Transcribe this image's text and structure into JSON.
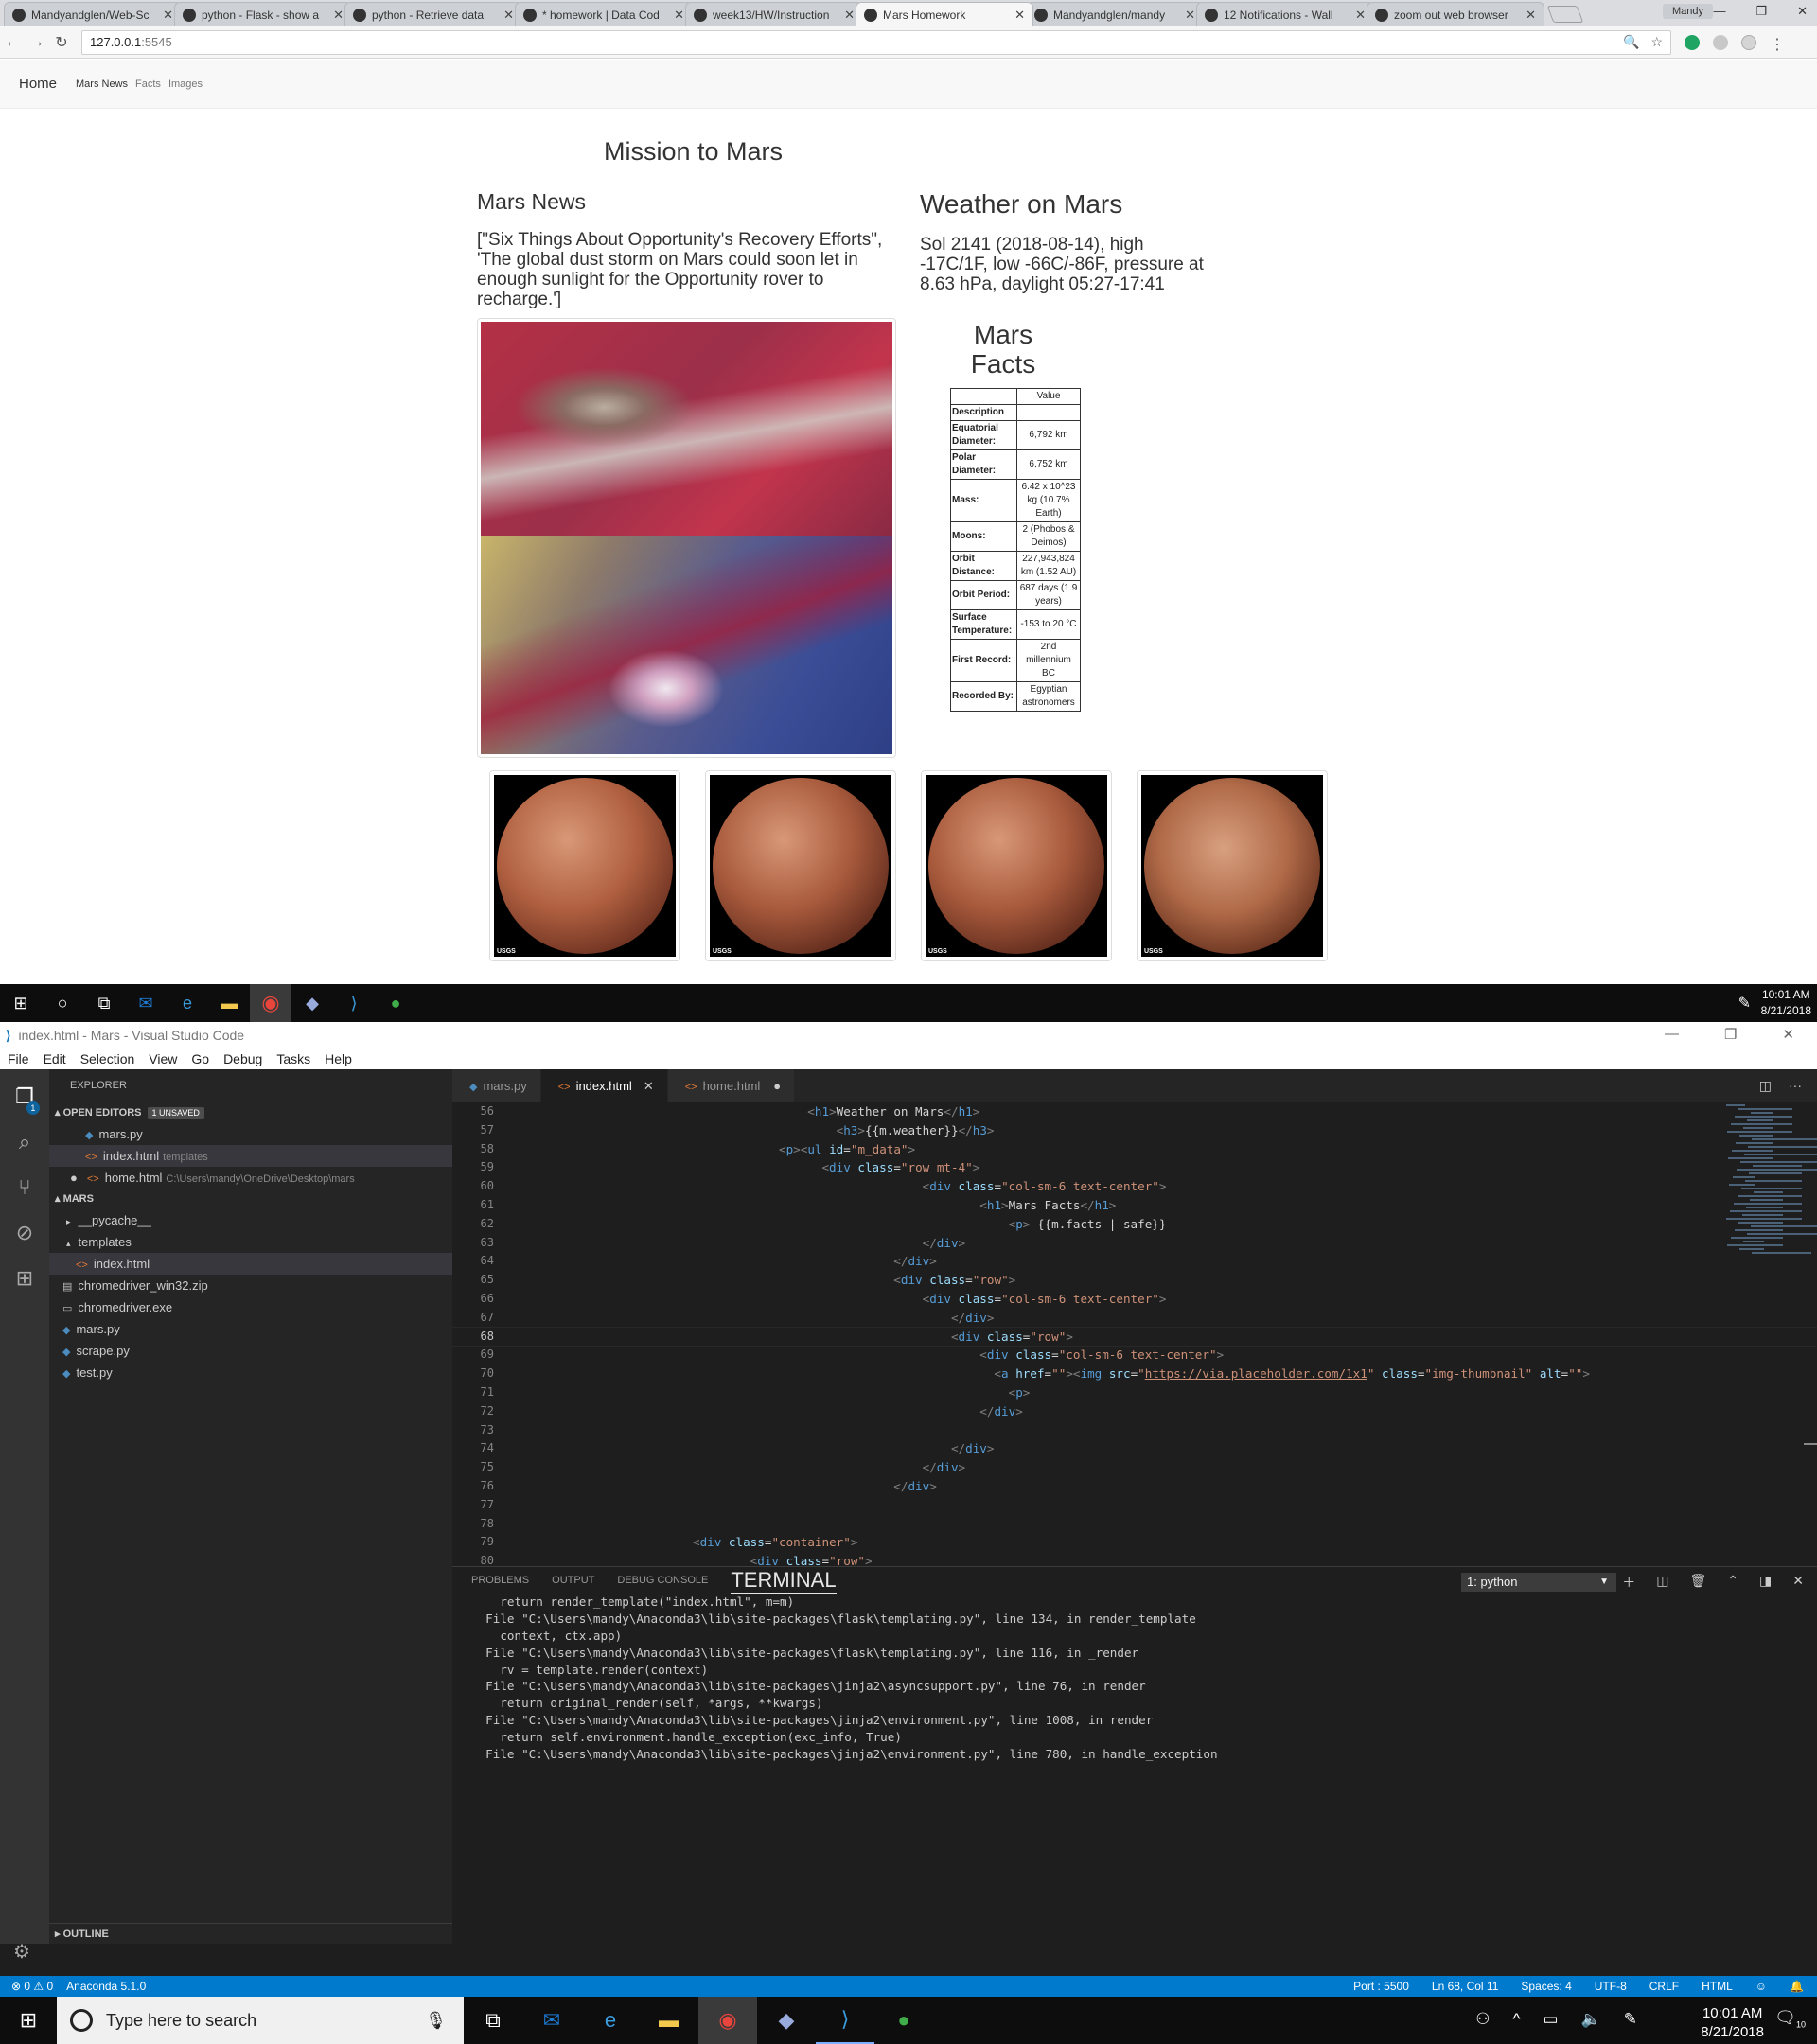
{
  "browser": {
    "tabs": [
      {
        "title": "Mandyandglen/Web-Sc",
        "active": false
      },
      {
        "title": "python - Flask - show a",
        "active": false
      },
      {
        "title": "python - Retrieve data",
        "active": false
      },
      {
        "title": "* homework | Data Cod",
        "active": false
      },
      {
        "title": "week13/HW/Instruction",
        "active": false
      },
      {
        "title": "Mars Homework",
        "active": true
      },
      {
        "title": "Mandyandglen/mandy",
        "active": false
      },
      {
        "title": "12 Notifications - Wall",
        "active": false
      },
      {
        "title": "zoom out web browser",
        "active": false
      }
    ],
    "user": "Mandy",
    "url_host": "127.0.0.1",
    "url_port": ":5545"
  },
  "site": {
    "nav": {
      "brand": "Home",
      "links": [
        "Mars News",
        "Facts",
        "Images"
      ]
    },
    "title": "Mission to Mars",
    "news_heading": "Mars News",
    "news_text": "[\"Six Things About Opportunity's Recovery Efforts\", 'The global dust storm on Mars could soon let in enough sunlight for the Opportunity rover to recharge.']",
    "weather_heading": "Weather on Mars",
    "weather_text": "Sol 2141 (2018-08-14), high -17C/1F, low -66C/-86F, pressure at 8.63 hPa, daylight 05:27-17:41",
    "facts_heading": "Mars Facts",
    "facts_table": {
      "col_header": "Value",
      "index_header": "Description",
      "rows": [
        {
          "k": "Equatorial Diameter:",
          "v": "6,792 km"
        },
        {
          "k": "Polar Diameter:",
          "v": "6,752 km"
        },
        {
          "k": "Mass:",
          "v": "6.42 x 10^23 kg (10.7% Earth)"
        },
        {
          "k": "Moons:",
          "v": "2 (Phobos & Deimos)"
        },
        {
          "k": "Orbit Distance:",
          "v": "227,943,824 km (1.52 AU)"
        },
        {
          "k": "Orbit Period:",
          "v": "687 days (1.9 years)"
        },
        {
          "k": "Surface Temperature:",
          "v": "-153 to 20 °C"
        },
        {
          "k": "First Record:",
          "v": "2nd millennium BC"
        },
        {
          "k": "Recorded By:",
          "v": "Egyptian astronomers"
        }
      ]
    },
    "hemisphere_badge": "USGS"
  },
  "taskbar_top": {
    "time": "10:01 AM",
    "date": "8/21/2018"
  },
  "vscode": {
    "title": "index.html - Mars - Visual Studio Code",
    "menu": [
      "File",
      "Edit",
      "Selection",
      "View",
      "Go",
      "Debug",
      "Tasks",
      "Help"
    ],
    "explorer": {
      "header": "EXPLORER",
      "open_editors": "OPEN EDITORS",
      "unsaved": "1 UNSAVED",
      "open_files": [
        {
          "name": "mars.py",
          "dim": ""
        },
        {
          "name": "index.html",
          "dim": "templates"
        },
        {
          "name": "home.html",
          "dim": "C:\\Users\\mandy\\OneDrive\\Desktop\\mars"
        }
      ],
      "folder": "MARS",
      "tree": [
        "__pycache__",
        "templates",
        "index.html",
        "chromedriver_win32.zip",
        "chromedriver.exe",
        "mars.py",
        "scrape.py",
        "test.py"
      ],
      "outline": "OUTLINE"
    },
    "editor_tabs": [
      {
        "name": "mars.py"
      },
      {
        "name": "index.html"
      },
      {
        "name": "home.html"
      }
    ],
    "current_line": 68,
    "panel": {
      "tabs": [
        "PROBLEMS",
        "OUTPUT",
        "DEBUG CONSOLE",
        "TERMINAL"
      ],
      "dropdown": "1: python",
      "terminal": [
        "    return render_template(\"index.html\", m=m)",
        "  File \"C:\\Users\\mandy\\Anaconda3\\lib\\site-packages\\flask\\templating.py\", line 134, in render_template",
        "    context, ctx.app)",
        "  File \"C:\\Users\\mandy\\Anaconda3\\lib\\site-packages\\flask\\templating.py\", line 116, in _render",
        "    rv = template.render(context)",
        "  File \"C:\\Users\\mandy\\Anaconda3\\lib\\site-packages\\jinja2\\asyncsupport.py\", line 76, in render",
        "    return original_render(self, *args, **kwargs)",
        "  File \"C:\\Users\\mandy\\Anaconda3\\lib\\site-packages\\jinja2\\environment.py\", line 1008, in render",
        "    return self.environment.handle_exception(exc_info, True)",
        "  File \"C:\\Users\\mandy\\Anaconda3\\lib\\site-packages\\jinja2\\environment.py\", line 780, in handle_exception"
      ]
    },
    "status": {
      "problems": "⊗ 0 ⚠ 0",
      "env": "Anaconda 5.1.0",
      "port": "Port : 5500",
      "position": "Ln 68, Col 11",
      "spaces": "Spaces: 4",
      "encoding": "UTF-8",
      "eol": "CRLF",
      "language": "HTML"
    }
  },
  "taskbar_bottom": {
    "search": "Type here to search",
    "time": "10:01 AM",
    "date": "8/21/2018",
    "notifications": "10"
  }
}
